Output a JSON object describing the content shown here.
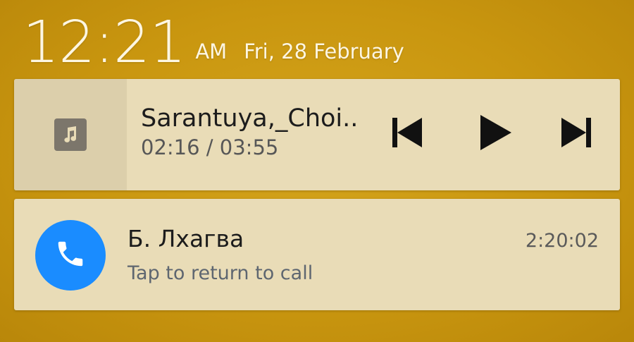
{
  "lockscreen": {
    "time": "12:21",
    "ampm": "AM",
    "date": "Fri, 28 February"
  },
  "media": {
    "title": "Sarantuya,_Choi..",
    "progress": "02:16 / 03:55",
    "art_icon": "music-note-icon",
    "controls": {
      "previous": "skip-previous-icon",
      "play": "play-icon",
      "next": "skip-next-icon"
    }
  },
  "call": {
    "name": "Б. Лхагва",
    "subtitle": "Tap to return to call",
    "timer": "2:20:02",
    "icon": "phone-icon",
    "avatar_color": "#1a8cff"
  },
  "colors": {
    "wallpaper": "#c9960f",
    "card": "#e9dcb7"
  }
}
